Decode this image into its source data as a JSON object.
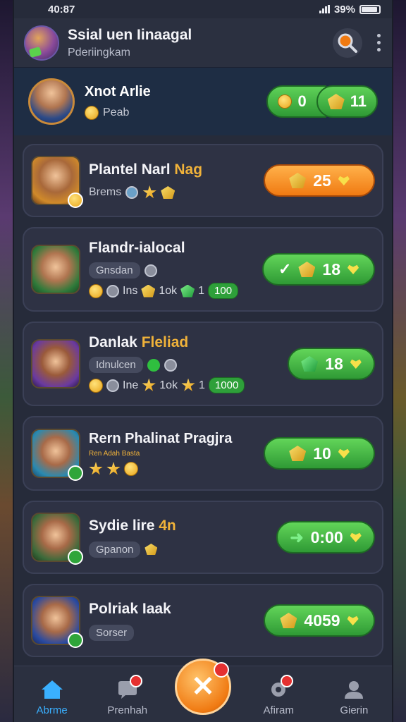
{
  "status_bar": {
    "time": "40:87",
    "battery": "39%"
  },
  "header": {
    "title": "Ssial uen Iinaagal",
    "subtitle": "Pderiingkam"
  },
  "profile": {
    "name": "Xnot Arlie",
    "sub_label": "Peab",
    "wallet_left": "0",
    "wallet_right": "11"
  },
  "cards": [
    {
      "title": "Plantel Narl",
      "title_accent": "Nag",
      "meta_label": "Brems",
      "reward": "25",
      "reward_style": "orange"
    },
    {
      "title": "Flandr-ialocal",
      "title_accent": "",
      "tag": "Gnsdan",
      "stat_a": "Ins",
      "stat_b": "1ok",
      "stat_c": "1",
      "stat_pill": "100",
      "reward": "18"
    },
    {
      "title": "Danlak",
      "title_accent": "Fleliad",
      "tag": "Idnulcen",
      "stat_a": "Ine",
      "stat_b": "1ok",
      "stat_c": "1",
      "stat_pill": "1000",
      "reward": "18"
    },
    {
      "title": "Rern Phalinat Pragjra",
      "title_accent": "",
      "tag": "Ren Adah Basta",
      "reward": "10"
    },
    {
      "title": "Sydie lire",
      "title_accent": "4n",
      "tag": "Gpanon",
      "reward": "0:00"
    },
    {
      "title": "Polriak Iaak",
      "title_accent": "",
      "tag": "Sorser",
      "reward": "4059"
    }
  ],
  "nav": {
    "home": "Abrme",
    "second": "Prenhah",
    "fourth": "Afiram",
    "fifth": "Gierin"
  },
  "colors": {
    "accent_green": "#2f9a35",
    "accent_orange": "#f07a12",
    "active_blue": "#3ab0ff"
  }
}
